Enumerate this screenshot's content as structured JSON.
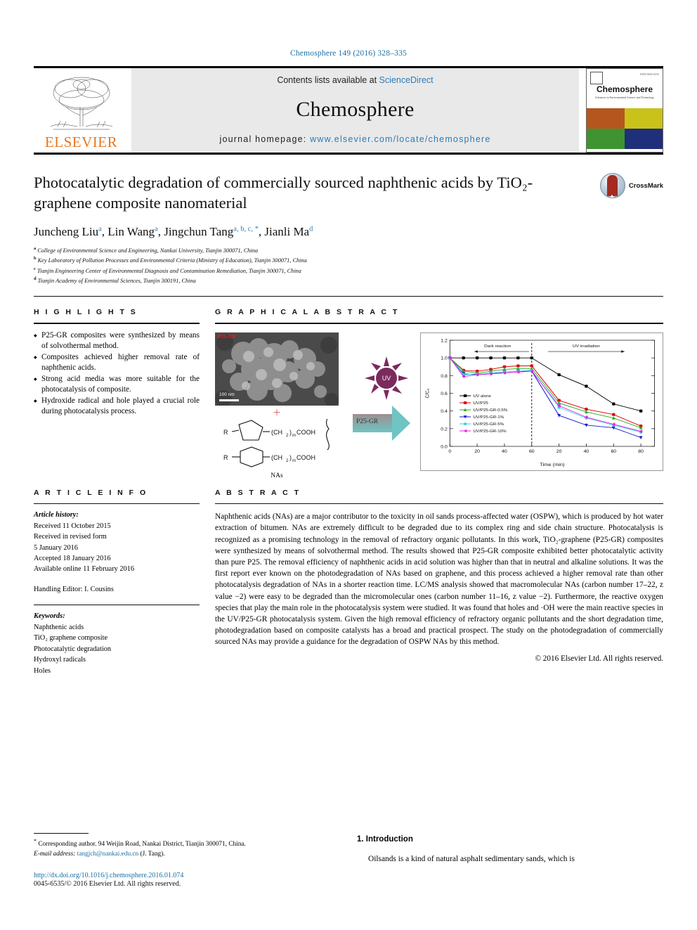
{
  "runninghead": "Chemosphere 149 (2016) 328–335",
  "masthead": {
    "publisher": "ELSEVIER",
    "contents_prefix": "Contents lists available at ",
    "contents_link": "ScienceDirect",
    "journal": "Chemosphere",
    "homepage_prefix": "journal homepage: ",
    "homepage_url": "www.elsevier.com/locate/chemosphere",
    "cover_title": "Chemosphere",
    "cover_subtitle": "Advances in Environmental Science and Technology",
    "cover_issn": "ISSN 0045-6535"
  },
  "article": {
    "title": "Photocatalytic degradation of commercially sourced naphthenic acids by TiO₂-graphene composite nanomaterial",
    "crossmark_label": "CrossMark",
    "authors_html": "Juncheng Liu, Lin Wang, Jingchun Tang, Jianli Ma",
    "authors": [
      {
        "name": "Juncheng Liu",
        "marks": "a"
      },
      {
        "name": "Lin Wang",
        "marks": "a"
      },
      {
        "name": "Jingchun Tang",
        "marks": "a, b, c, *"
      },
      {
        "name": "Jianli Ma",
        "marks": "d"
      }
    ],
    "affiliations": [
      {
        "label": "a",
        "text": "College of Environmental Science and Engineering, Nankai University, Tianjin 300071, China"
      },
      {
        "label": "b",
        "text": "Key Laboratory of Pollution Processes and Environmental Criteria (Ministry of Education), Tianjin 300071, China"
      },
      {
        "label": "c",
        "text": "Tianjin Engineering Center of Environmental Diagnosis and Contamination Remediation, Tianjin 300071, China"
      },
      {
        "label": "d",
        "text": "Tianjin Academy of Environmental Sciences, Tianjin 300191, China"
      }
    ]
  },
  "highlights": {
    "heading": "H I G H L I G H T S",
    "items": [
      "P25-GR composites were synthesized by means of solvothermal method.",
      "Composites achieved higher removal rate of naphthenic acids.",
      "Strong acid media was more suitable for the photocatalysis of composite.",
      "Hydroxide radical and hole played a crucial role during photocatalysis process."
    ]
  },
  "graphical_abstract": {
    "heading": "G R A P H I C A L   A B S T R A C T",
    "sem_label": "P25-GR",
    "sem_scale": "100 nm",
    "plus": "+",
    "nas_label": "NAs",
    "molecule_1": "R—⬠—(CH₂)ₘCOOH",
    "molecule_2": "R—⬡—(CH₂)ₘCOOH",
    "uv_label": "UV",
    "arrow_label": "P25-GR"
  },
  "chart_data": {
    "type": "line",
    "title": "",
    "xlabel": "Time (min)",
    "ylabel": "C/C₀",
    "xlim": [
      0,
      150
    ],
    "ylim": [
      0.0,
      1.2
    ],
    "ytick_labels": [
      "0.0",
      "0.2",
      "0.4",
      "0.6",
      "0.8",
      "1.0",
      "1.2"
    ],
    "yticks": [
      0.0,
      0.2,
      0.4,
      0.6,
      0.8,
      1.0,
      1.2
    ],
    "xtick_labels": [
      "0",
      "20",
      "40",
      "60",
      "20",
      "40",
      "60",
      "80"
    ],
    "xticks": [
      0,
      20,
      40,
      60,
      80,
      100,
      120,
      140
    ],
    "grid": false,
    "legend_position": "lower-left",
    "annotations": [
      {
        "text": "Dark reaction",
        "x": 35,
        "y": 1.12
      },
      {
        "text": "UV irradiation",
        "x": 100,
        "y": 1.12
      }
    ],
    "divider_x": 60,
    "x": [
      0,
      10,
      20,
      30,
      40,
      50,
      60,
      80,
      100,
      120,
      140
    ],
    "series": [
      {
        "name": "UV alone",
        "color": "#000000",
        "marker": "square",
        "values": [
          1.0,
          1.0,
          1.0,
          1.0,
          1.0,
          1.0,
          1.0,
          0.81,
          0.68,
          0.48,
          0.4
        ]
      },
      {
        "name": "UV/P25",
        "color": "#e00000",
        "marker": "square",
        "values": [
          1.0,
          0.86,
          0.85,
          0.87,
          0.9,
          0.91,
          0.91,
          0.52,
          0.42,
          0.36,
          0.23
        ]
      },
      {
        "name": "UV/P25-GR-0.5%",
        "color": "#22b022",
        "marker": "triangle",
        "values": [
          1.0,
          0.85,
          0.83,
          0.85,
          0.87,
          0.88,
          0.88,
          0.49,
          0.39,
          0.32,
          0.21
        ]
      },
      {
        "name": "UV/P25-GR-1%",
        "color": "#1a1ad0",
        "marker": "triangle-down",
        "values": [
          1.0,
          0.82,
          0.81,
          0.82,
          0.84,
          0.85,
          0.85,
          0.35,
          0.24,
          0.21,
          0.1
        ]
      },
      {
        "name": "UV/P25-GR-5%",
        "color": "#35d2e8",
        "marker": "circle",
        "values": [
          1.0,
          0.81,
          0.82,
          0.83,
          0.84,
          0.85,
          0.86,
          0.44,
          0.32,
          0.24,
          0.16
        ]
      },
      {
        "name": "UV/P25-GR-10%",
        "color": "#e020e0",
        "marker": "triangle-left",
        "values": [
          1.0,
          0.79,
          0.81,
          0.82,
          0.83,
          0.84,
          0.85,
          0.46,
          0.33,
          0.25,
          0.17
        ]
      }
    ]
  },
  "article_info": {
    "heading": "A R T I C L E   I N F O",
    "history_label": "Article history:",
    "history": [
      "Received 11 October 2015",
      "Received in revised form",
      "5 January 2016",
      "Accepted 18 January 2016",
      "Available online 11 February 2016"
    ],
    "handling_editor": "Handling Editor: I. Cousins",
    "keywords_label": "Keywords:",
    "keywords": [
      "Naphthenic acids",
      "TiO₂ graphene composite",
      "Photocatalytic degradation",
      "Hydroxyl radicals",
      "Holes"
    ]
  },
  "abstract": {
    "heading": "A B S T R A C T",
    "body": "Naphthenic acids (NAs) are a major contributor to the toxicity in oil sands process-affected water (OSPW), which is produced by hot water extraction of bitumen. NAs are extremely difficult to be degraded due to its complex ring and side chain structure. Photocatalysis is recognized as a promising technology in the removal of refractory organic pollutants. In this work, TiO₂-graphene (P25-GR) composites were synthesized by means of solvothermal method. The results showed that P25-GR composite exhibited better photocatalytic activity than pure P25. The removal efficiency of naphthenic acids in acid solution was higher than that in neutral and alkaline solutions. It was the first report ever known on the photodegradation of NAs based on graphene, and this process achieved a higher removal rate than other photocatalysis degradation of NAs in a shorter reaction time. LC/MS analysis showed that macromolecular NAs (carbon number 17–22, z value −2) were easy to be degraded than the micromolecular ones (carbon number 11–16, z value −2). Furthermore, the reactive oxygen species that play the main role in the photocatalysis system were studied. It was found that holes and ·OH were the main reactive species in the UV/P25-GR photocatalysis system. Given the high removal efficiency of refractory organic pollutants and the short degradation time, photodegradation based on composite catalysts has a broad and practical prospect. The study on the photodegradation of commercially sourced NAs may provide a guidance for the degradation of OSPW NAs by this method.",
    "copyright": "© 2016 Elsevier Ltd. All rights reserved."
  },
  "footnote": {
    "star": "*",
    "corresponding": " Corresponding author. 94 Weijin Road, Nankai District, Tianjin 300071, China.",
    "email_label": "E-mail address:",
    "email": "tangjch@nankai.edu.cn",
    "email_owner": " (J. Tang).",
    "doi": "http://dx.doi.org/10.1016/j.chemosphere.2016.01.074",
    "issn_line": "0045-6535/© 2016 Elsevier Ltd. All rights reserved."
  },
  "introduction": {
    "heading": "1.  Introduction",
    "first_line": "Oilsands is a kind of natural asphalt sedimentary sands, which is"
  }
}
